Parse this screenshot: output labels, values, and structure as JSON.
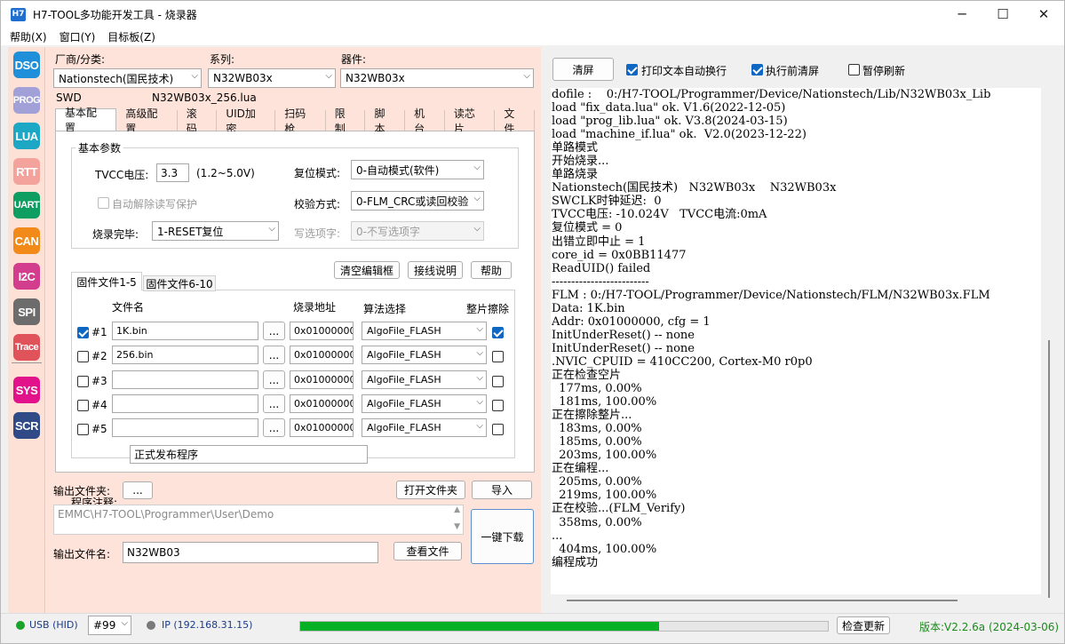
{
  "window": {
    "app_icon": "H7",
    "title": "H7-TOOL多功能开发工具 - 烧录器",
    "minimize": "─",
    "maximize": "☐",
    "close": "✕"
  },
  "menu": [
    "帮助(X)",
    "窗口(Y)",
    "目标板(Z)"
  ],
  "sidebar": [
    {
      "label": "DSO",
      "color": "#1e8fd8"
    },
    {
      "label": "PROG",
      "color": "#a1a1d8"
    },
    {
      "label": "LUA",
      "color": "#1ca7c4"
    },
    {
      "label": "RTT",
      "color": "#f4a39c"
    },
    {
      "label": "UART",
      "color": "#0e9e62"
    },
    {
      "label": "CAN",
      "color": "#f28a19"
    },
    {
      "label": "I2C",
      "color": "#d23d8d"
    },
    {
      "label": "SPI",
      "color": "#6c6c6c"
    },
    {
      "label": "Trace",
      "color": "#e0535a"
    },
    {
      "label": "SYS",
      "color": "#e2138a"
    },
    {
      "label": "SCR",
      "color": "#2f4a86"
    }
  ],
  "device": {
    "vendor_label": "厂商/分类:",
    "vendor_value": "Nationstech(国民技术)",
    "series_label": "系列:",
    "series_value": "N32WB03x",
    "device_label": "器件:",
    "device_value": "N32WB03x",
    "interface": "SWD",
    "lua_file": "N32WB03x_256.lua"
  },
  "tabs": [
    "基本配置",
    "高级配置",
    "滚码",
    "UID加密",
    "扫码枪",
    "限制",
    "脚本",
    "机台",
    "读芯片",
    "文件"
  ],
  "basic": {
    "group_title": "基本参数",
    "vtcc_label": "TVCC电压:",
    "vtcc_value": "3.3",
    "vtcc_range": "(1.2~5.0V)",
    "reset_label": "复位模式:",
    "reset_value": "0-自动模式(软件)",
    "auto_unprotect": "自动解除读写保护",
    "verify_label": "校验方式:",
    "verify_value": "0-FLM_CRC或读回校验",
    "done_label": "烧录完毕:",
    "done_value": "1-RESET复位",
    "option_label": "写选项字:",
    "option_value": "0-不写选项字"
  },
  "files": {
    "clear_btn": "清空编辑框",
    "wiring_btn": "接线说明",
    "help_btn": "帮助",
    "subtab1": "固件文件1-5",
    "subtab2": "固件文件6-10",
    "col_file": "文件名",
    "col_addr": "烧录地址",
    "col_algo": "算法选择",
    "col_erase": "整片擦除",
    "rows": [
      {
        "idx": "#1",
        "checked": true,
        "file": "1K.bin",
        "addr": "0x01000000",
        "algo": "AlgoFile_FLASH",
        "erase": true
      },
      {
        "idx": "#2",
        "checked": false,
        "file": "256.bin",
        "addr": "0x01000000",
        "algo": "AlgoFile_FLASH",
        "erase": false
      },
      {
        "idx": "#3",
        "checked": false,
        "file": "",
        "addr": "0x01000000",
        "algo": "AlgoFile_FLASH",
        "erase": false
      },
      {
        "idx": "#4",
        "checked": false,
        "file": "",
        "addr": "0x01000000",
        "algo": "AlgoFile_FLASH",
        "erase": false
      },
      {
        "idx": "#5",
        "checked": false,
        "file": "",
        "addr": "0x01000000",
        "algo": "AlgoFile_FLASH",
        "erase": false
      }
    ],
    "browse": "...",
    "comment_label": "程序注释:",
    "comment_value": "正式发布程序"
  },
  "output": {
    "folder_label": "输出文件夹:",
    "folder_btn": "...",
    "open_folder_btn": "打开文件夹",
    "import_btn": "导入",
    "path": "EMMC\\H7-TOOL\\Programmer\\User\\Demo",
    "download_btn": "一键下载",
    "name_label": "输出文件名:",
    "name_value": "N32WB03",
    "view_btn": "查看文件"
  },
  "console_toolbar": {
    "clear_btn": "清屏",
    "auto_wrap": "打印文本自动换行",
    "clear_before": "执行前清屏",
    "pause": "暂停刷新"
  },
  "console_lines": [
    "dofile :    0:/H7-TOOL/Programmer/Device/Nationstech/Lib/N32WB03x_Lib",
    "load \"fix_data.lua\" ok. V1.6(2022-12-05)",
    "load \"prog_lib.lua\" ok. V3.8(2024-03-15)",
    "load \"machine_if.lua\" ok.  V2.0(2023-12-22)",
    "单路模式",
    "开始烧录...",
    "单路烧录",
    "Nationstech(国民技术)   N32WB03x    N32WB03x",
    "SWCLK时钟延迟:  0",
    "TVCC电压: -10.024V   TVCC电流:0mA",
    "复位模式 = 0",
    "出错立即中止 = 1",
    "core_id = 0x0BB11477",
    "ReadUID() failed",
    "-------------------------",
    "FLM : 0:/H7-TOOL/Programmer/Device/Nationstech/FLM/N32WB03x.FLM",
    "Data: 1K.bin",
    "Addr: 0x01000000, cfg = 1",
    "InitUnderReset() -- none",
    "InitUnderReset() -- none",
    ".NVIC_CPUID = 410CC200, Cortex-M0 r0p0",
    "正在检查空片",
    "  177ms, 0.00%",
    "  181ms, 100.00%",
    "正在擦除整片...",
    "  183ms, 0.00%",
    "  185ms, 0.00%",
    "  203ms, 100.00%",
    "正在编程...",
    "  205ms, 0.00%",
    "  219ms, 100.00%",
    "正在校验...(FLM_Verify)",
    "  358ms, 0.00%",
    "...",
    "  404ms, 100.00%",
    "编程成功"
  ],
  "status": {
    "usb": "USB (HID)",
    "usb_color": "#1aa32a",
    "dev_no": "#99",
    "ip": "IP (192.168.31.15)",
    "ip_color": "#7a7a7a",
    "progress": 0.68,
    "check_update": "检查更新",
    "version": "版本:V2.2.6a (2024-03-06)",
    "version_color": "#1b8a1b"
  }
}
